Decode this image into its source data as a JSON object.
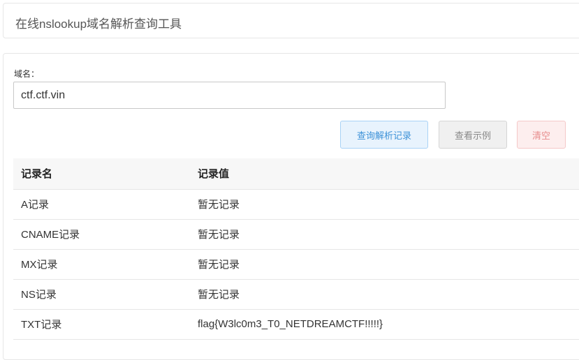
{
  "header": {
    "title": "在线nslookup域名解析查询工具"
  },
  "form": {
    "domain_label": "域名：",
    "domain_value": "ctf.ctf.vin"
  },
  "buttons": {
    "query": "查询解析记录",
    "example": "查看示例",
    "clear": "清空"
  },
  "colors": {
    "query_button": "#3d92d8",
    "clear_button": "#e78c8c"
  },
  "table": {
    "headers": [
      "记录名",
      "记录值"
    ],
    "rows": [
      {
        "name": "A记录",
        "value": "暂无记录"
      },
      {
        "name": "CNAME记录",
        "value": "暂无记录"
      },
      {
        "name": "MX记录",
        "value": "暂无记录"
      },
      {
        "name": "NS记录",
        "value": "暂无记录"
      },
      {
        "name": "TXT记录",
        "value": "flag{W3lc0m3_T0_NETDREAMCTF!!!!!}"
      }
    ]
  }
}
